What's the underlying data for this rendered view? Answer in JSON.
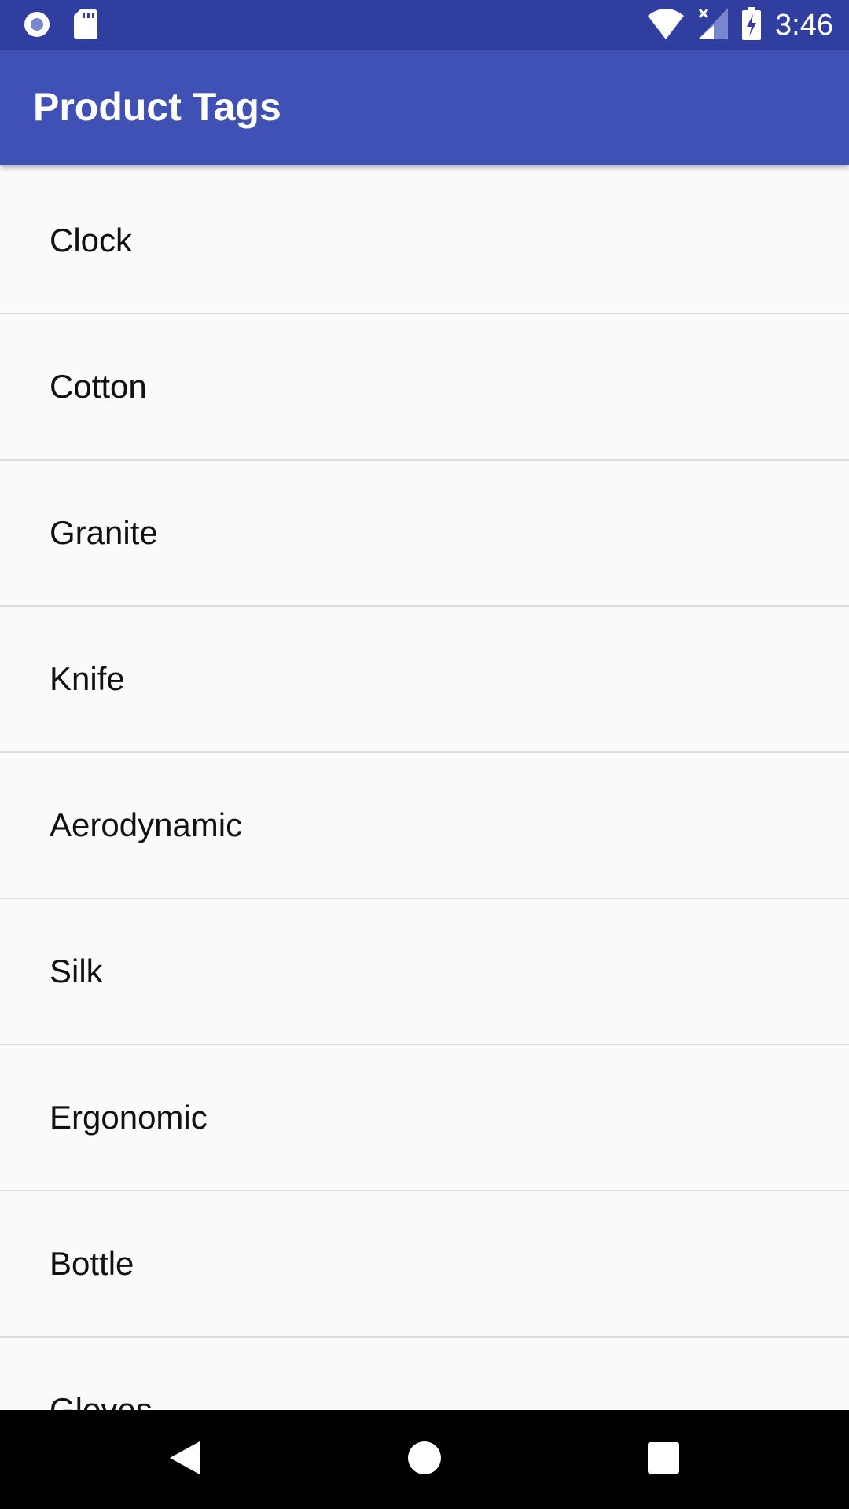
{
  "status_bar": {
    "time": "3:46",
    "icons": [
      "radio-icon",
      "sd-card-icon",
      "wifi-icon",
      "cellular-no-signal-icon",
      "battery-charging-icon"
    ]
  },
  "app_bar": {
    "title": "Product Tags",
    "color": "#3f51b5"
  },
  "list": {
    "items": [
      "Clock",
      "Cotton",
      "Granite",
      "Knife",
      "Aerodynamic",
      "Silk",
      "Ergonomic",
      "Bottle",
      "Gloves"
    ]
  },
  "nav_bar": {
    "buttons": [
      "back-icon",
      "home-icon",
      "recents-icon"
    ]
  }
}
